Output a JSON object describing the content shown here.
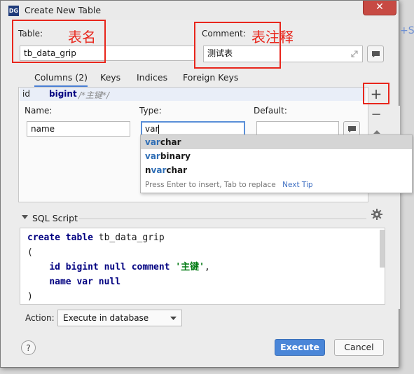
{
  "window": {
    "title": "Create New Table",
    "app_icon": "DG",
    "close_glyph": "✕",
    "side_fragment": "+S"
  },
  "annotations": {
    "table_note": "表名",
    "comment_note": "表注释"
  },
  "table_field": {
    "label": "Table:",
    "value": "tb_data_grip"
  },
  "comment_field": {
    "label": "Comment:",
    "value": "测试表"
  },
  "tabs": [
    {
      "label": "Columns (2)",
      "active": true
    },
    {
      "label": "Keys"
    },
    {
      "label": "Indices"
    },
    {
      "label": "Foreign Keys"
    }
  ],
  "column_row": {
    "name": "id",
    "type": "bigint",
    "comment": "/*主键*/"
  },
  "column_editor": {
    "name_label": "Name:",
    "name_value": "name",
    "type_label": "Type:",
    "type_value": "var",
    "default_label": "Default:",
    "default_value": ""
  },
  "side_buttons": {
    "add": "+",
    "remove": "−"
  },
  "autocomplete": {
    "items": [
      {
        "pre": "",
        "match": "var",
        "post": "char",
        "selected": true
      },
      {
        "pre": "",
        "match": "var",
        "post": "binary"
      },
      {
        "pre": "n",
        "match": "var",
        "post": "char"
      }
    ],
    "hint": "Press Enter to insert, Tab to replace",
    "tip_link": "Next Tip"
  },
  "sql_section": {
    "title": "SQL Script",
    "lines": [
      {
        "kw": "create table",
        "rest": " tb_data_grip"
      },
      {
        "rest": "("
      },
      {
        "indent": "    ",
        "kw": "id bigint null comment",
        "str": " '主键'",
        "tail": ","
      },
      {
        "indent": "    ",
        "kw": "name var null"
      },
      {
        "rest": ")"
      }
    ]
  },
  "action": {
    "label": "Action:",
    "value": "Execute in database"
  },
  "footer": {
    "help": "?",
    "execute": "Execute",
    "cancel": "Cancel"
  },
  "colors": {
    "accent": "#4a7fd4",
    "annotation": "#e8261c",
    "keyword": "#000080"
  }
}
